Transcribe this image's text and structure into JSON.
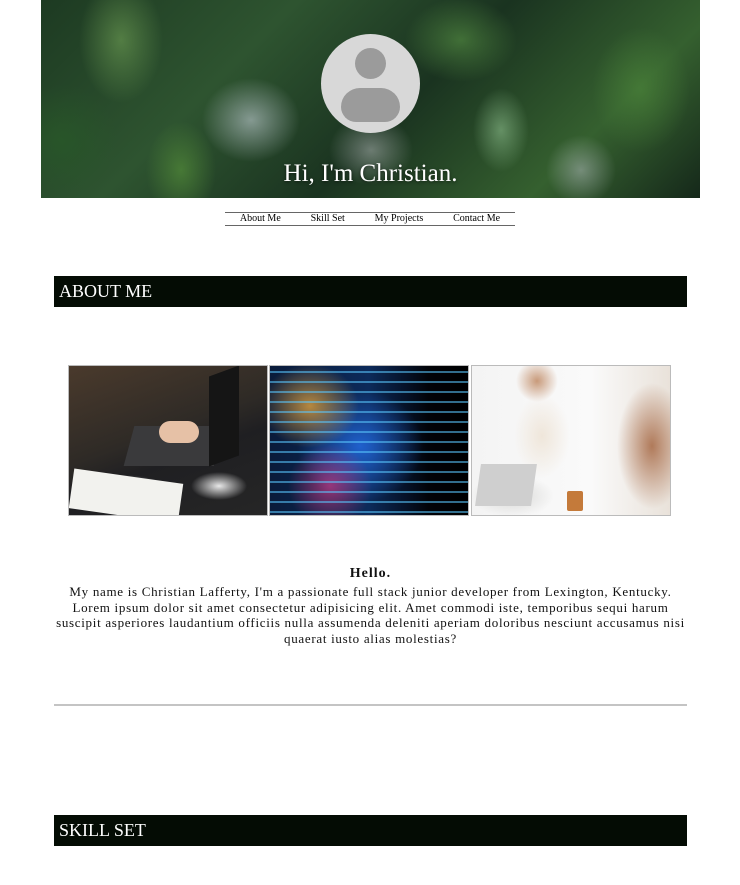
{
  "hero": {
    "title": "Hi, I'm Christian."
  },
  "nav": {
    "items": [
      {
        "label": "About Me"
      },
      {
        "label": "Skill Set"
      },
      {
        "label": "My Projects"
      },
      {
        "label": "Contact Me"
      }
    ]
  },
  "sections": {
    "about": {
      "title": "ABOUT ME"
    },
    "skills": {
      "title": "SKILL SET"
    }
  },
  "intro": {
    "heading": "Hello.",
    "body": "My name is Christian Lafferty, I'm a passionate full stack junior developer from Lexington, Kentucky. Lorem ipsum dolor sit amet consectetur adipisicing elit. Amet commodi iste, temporibus sequi harum suscipit asperiores laudantium officiis nulla assumenda deleniti aperiam doloribus nesciunt accusamus nisi quaerat iusto alias molestias?"
  },
  "colors": {
    "section_header_bg": "#040c04",
    "divider": "#c4c4c4"
  }
}
